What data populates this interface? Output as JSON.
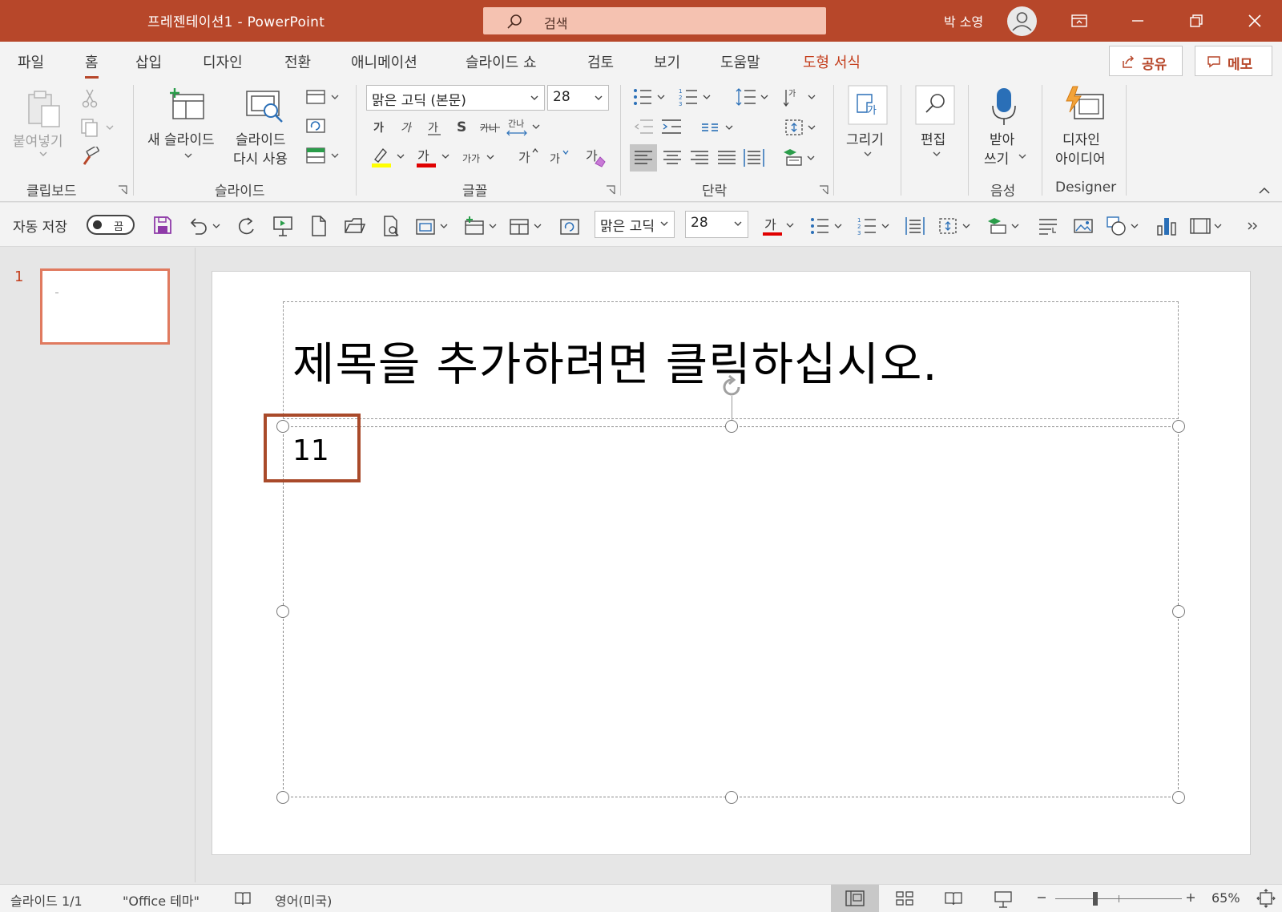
{
  "app": {
    "doc_title": "프레젠테이션1  -  PowerPoint",
    "search_placeholder": "검색",
    "user_name": "박 소영"
  },
  "tabs": [
    "파일",
    "홈",
    "삽입",
    "디자인",
    "전환",
    "애니메이션",
    "슬라이드 쇼",
    "검토",
    "보기",
    "도움말",
    "도형 서식"
  ],
  "active_tab": "홈",
  "share_label": "공유",
  "comment_label": "메모",
  "ribbon": {
    "clipboard": {
      "label": "클립보드",
      "paste": "붙여넣기"
    },
    "slides": {
      "label": "슬라이드",
      "new_slide": "새 슬라이드",
      "reuse_line1": "슬라이드",
      "reuse_line2": "다시 사용"
    },
    "font": {
      "label": "글꼴",
      "font_name": "맑은 고딕 (본문)",
      "font_size": "28"
    },
    "paragraph": {
      "label": "단락"
    },
    "drawing": {
      "label": "그리기"
    },
    "editing": {
      "label": "편집"
    },
    "voice": {
      "label": "음성",
      "dictate_line1": "받아",
      "dictate_line2": "쓰기"
    },
    "designer": {
      "label": "Designer",
      "ideas_line1": "디자인",
      "ideas_line2": "아이디어"
    }
  },
  "qat": {
    "autosave_label": "자동 저장",
    "autosave_state": "끔",
    "font_name": "맑은 고딕",
    "font_size": "28"
  },
  "thumbnail": {
    "number": "1"
  },
  "slide": {
    "title_placeholder": "제목을 추가하려면 클릭하십시오.",
    "body_text": "11"
  },
  "status": {
    "slide_count": "슬라이드 1/1",
    "theme": "\"Office 테마\"",
    "language": "영어(미국)",
    "zoom": "65%"
  },
  "colors": {
    "accent": "#b7472a",
    "contextual_tab": "#c43e1c",
    "highlight_yellow": "#ffff00",
    "font_red": "#e00000"
  }
}
